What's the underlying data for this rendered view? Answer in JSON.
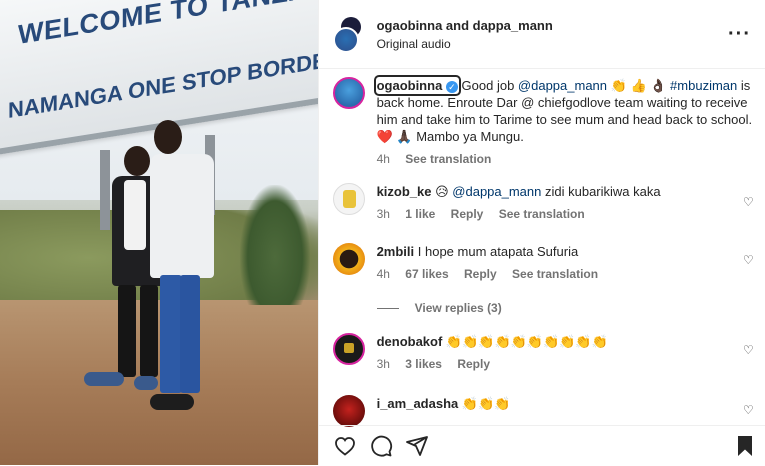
{
  "media": {
    "sign_line1": "WELCOME TO TANZANIA",
    "sign_line2": "NAMANGA ONE STOP BORDER PO"
  },
  "header": {
    "names": "ogaobinna and dappa_mann",
    "audio": "Original audio",
    "more_icon": "more-horizontal-icon"
  },
  "caption": {
    "username": "ogaobinna",
    "text_part1": " Good job ",
    "mention": "@dappa_mann",
    "emojis_1": " 👏 👍 👌🏿 ",
    "hashtag": "#mbuziman",
    "text_part2": " is back home. Enroute Dar @ chiefgodlove team waiting to receive him and take him to Tarime to see mum and head back to school.",
    "emojis_2": "❤️ 🙏🏿 ",
    "text_part3": "Mambo ya Mungu.",
    "time": "4h",
    "see_translation": "See translation"
  },
  "comments": [
    {
      "username": "kizob_ke",
      "pre": " 😥 ",
      "mention": "@dappa_mann",
      "text": " zidi kubarikiwa kaka",
      "time": "3h",
      "likes": "1 like",
      "reply": "Reply",
      "see_translation": "See translation"
    },
    {
      "username": "2mbili",
      "text": " I hope mum atapata Sufuria",
      "time": "4h",
      "likes": "67 likes",
      "reply": "Reply",
      "see_translation": "See translation",
      "view_replies": "View replies (3)"
    },
    {
      "username": "denobakof",
      "text": " 👏👏👏👏👏👏👏👏👏👏",
      "time": "3h",
      "likes": "3 likes",
      "reply": "Reply"
    },
    {
      "username": "i_am_adasha",
      "text": " 👏👏👏"
    }
  ],
  "actions": {
    "like_icon": "heart-icon",
    "comment_icon": "comment-icon",
    "share_icon": "share-icon",
    "save_icon": "bookmark-icon"
  },
  "colors": {
    "link": "#00376b",
    "muted": "#737373",
    "verified": "#3897f0",
    "ring": "#d6249f"
  }
}
